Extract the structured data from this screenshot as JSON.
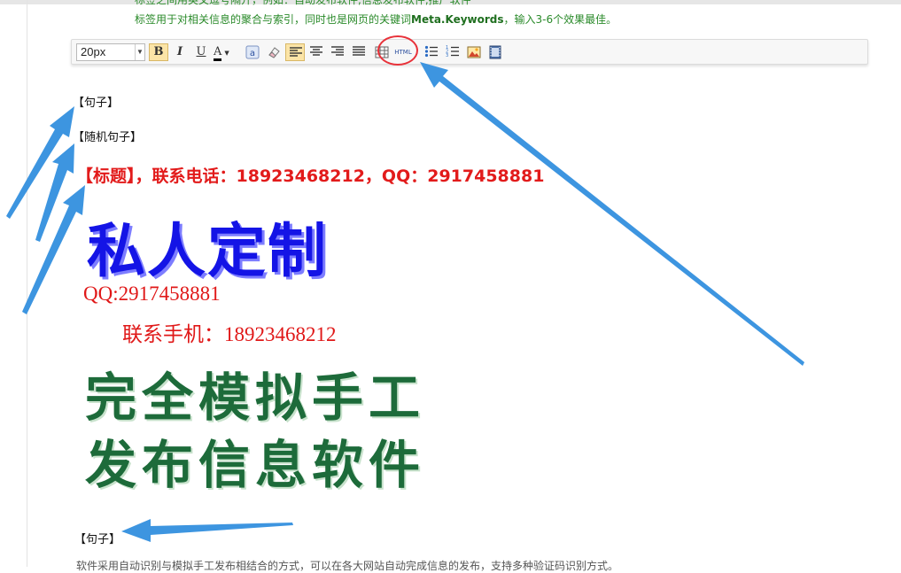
{
  "page": {
    "hint_clipped": "标签之间用英文逗号隔开，例如：自动发布软件,信息发布软件,推广软件",
    "hint_prefix": "标签用于对相关信息的聚合与索引，同时也是网页的关键词",
    "hint_keyword": "Meta.Keywords",
    "hint_suffix": "，输入3-6个效果最佳。"
  },
  "toolbar": {
    "font_size": "20px",
    "bold": "B",
    "italic": "I",
    "underline": "U",
    "font_color": "A",
    "html_label": "HTML",
    "icons": [
      "bold-icon",
      "italic-icon",
      "underline-icon",
      "font-color-icon",
      "background-color-icon",
      "eraser-icon",
      "align-left-icon",
      "align-center-icon",
      "align-right-icon",
      "align-justify-icon",
      "table-icon",
      "html-source-icon",
      "unordered-list-icon",
      "ordered-list-icon",
      "image-icon",
      "video-icon"
    ]
  },
  "editor": {
    "token_sentence_1": "【句子】",
    "token_random_sentence": "【随机句子】",
    "title_line": "【标题】，联系电话：18923468212，QQ：2917458881",
    "ad": {
      "headline": "私人定制",
      "qq": "QQ:2917458881",
      "phone": "联系手机：18923468212",
      "line1": "完全模拟手工",
      "line2": "发布信息软件"
    },
    "token_sentence_2": "【句子】",
    "bottom_text": "软件采用自动识别与模拟手工发布相结合的方式，可以在各大网站自动完成信息的发布，支持多种验证码识别方式。"
  },
  "colors": {
    "hint_green": "#2a8a2a",
    "title_red": "#e21b1b",
    "ad_blue": "#1414e6",
    "ad_green": "#1d6b3a",
    "annotation_blue": "#3d95e0",
    "circle_red": "#e8323a",
    "active_button": "#fbe4a7"
  }
}
